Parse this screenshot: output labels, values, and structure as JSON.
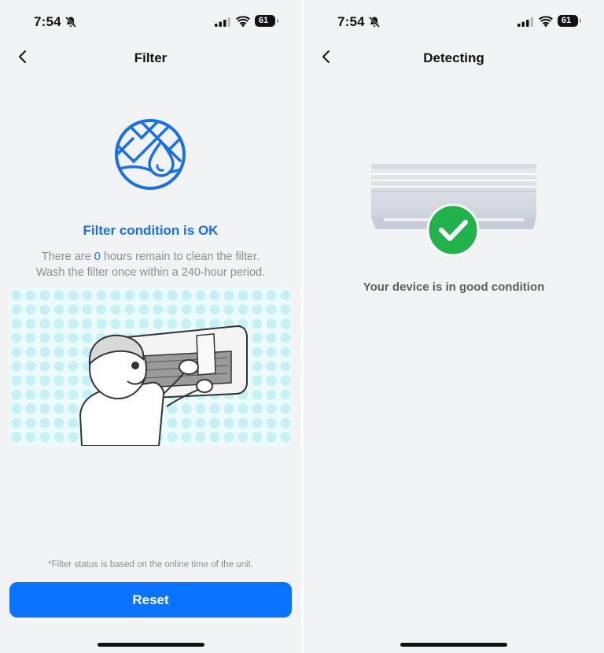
{
  "status_bar": {
    "time": "7:54",
    "battery": "61"
  },
  "filter_screen": {
    "title": "Filter",
    "status_title": "Filter condition is OK",
    "desc_prefix": "There are ",
    "hours_value": "0",
    "desc_suffix": " hours remain to clean the filter.",
    "desc_line2": "Wash the filter once within a 240-hour period.",
    "footnote": "*Filter status is based on the online time of the unit.",
    "reset_label": "Reset"
  },
  "detecting_screen": {
    "title": "Detecting",
    "status_text": "Your device is in good condition"
  },
  "colors": {
    "accent": "#1a6fe8",
    "button": "#0a73ff",
    "success": "#22b24c",
    "background": "#f2f3f5"
  },
  "icons": [
    "bell-slash-icon",
    "cellular-signal-icon",
    "wifi-icon",
    "battery-icon",
    "back-chevron-icon",
    "filter-water-icon",
    "checkmark-icon"
  ]
}
